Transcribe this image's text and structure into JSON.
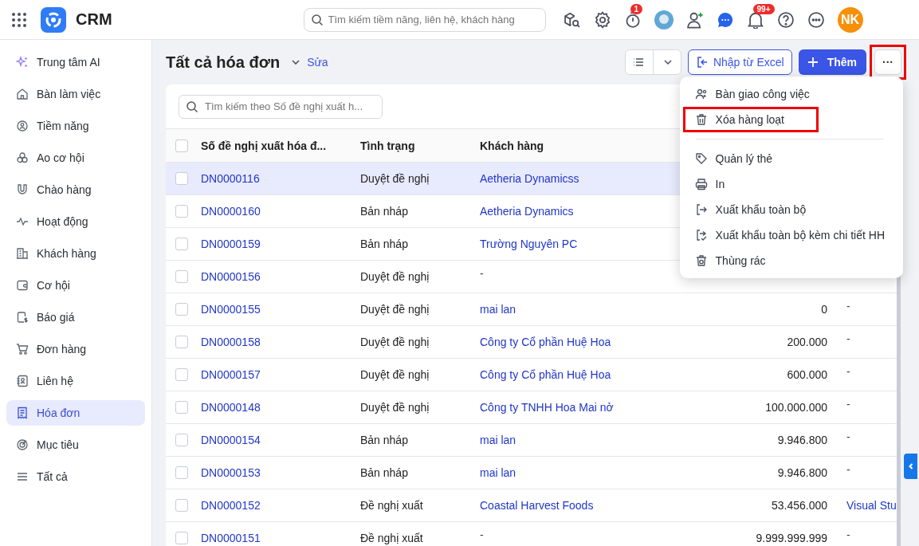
{
  "app": {
    "name": "CRM"
  },
  "search": {
    "placeholder": "Tìm kiếm tiềm năng, liên hệ, khách hàng"
  },
  "notifications": {
    "timer_badge": "1",
    "bell_badge": "99+"
  },
  "user": {
    "initials": "NK"
  },
  "sidebar": {
    "items": [
      {
        "label": "Trung tâm AI",
        "selected": false
      },
      {
        "label": "Bàn làm việc",
        "selected": false
      },
      {
        "label": "Tiềm năng",
        "selected": false
      },
      {
        "label": "Ao cơ hội",
        "selected": false
      },
      {
        "label": "Chào hàng",
        "selected": false
      },
      {
        "label": "Hoạt động",
        "selected": false
      },
      {
        "label": "Khách hàng",
        "selected": false
      },
      {
        "label": "Cơ hội",
        "selected": false
      },
      {
        "label": "Báo giá",
        "selected": false
      },
      {
        "label": "Đơn hàng",
        "selected": false
      },
      {
        "label": "Liên hệ",
        "selected": false
      },
      {
        "label": "Hóa đơn",
        "selected": true
      },
      {
        "label": "Mục tiêu",
        "selected": false
      },
      {
        "label": "Tất cả",
        "selected": false
      }
    ]
  },
  "page": {
    "title": "Tất cả hóa đơn",
    "edit_link": "Sửa",
    "import_button": "Nhập từ Excel",
    "add_button": "Thêm",
    "more_button": {
      "label": "···",
      "highlighted": true
    }
  },
  "table": {
    "search_placeholder": "Tìm kiếm theo Số đề nghị xuất h...",
    "select_all": {
      "checked": false
    },
    "columns": [
      "Số đề nghị xuất hóa đ...",
      "Tình trạng",
      "Khách hàng"
    ],
    "rows": [
      {
        "number": "DN0000116",
        "status": "Duyệt đề nghị",
        "customer": "Aetheria Dynamicss",
        "selected": true,
        "checked": false
      },
      {
        "number": "DN0000160",
        "status": "Bản nháp",
        "customer": "Aetheria Dynamics",
        "selected": false,
        "checked": false
      },
      {
        "number": "DN0000159",
        "status": "Bản nháp",
        "customer": "Trường Nguyên PC",
        "selected": false,
        "checked": false
      },
      {
        "number": "DN0000156",
        "status": "Duyệt đề nghị",
        "customer": "-",
        "customer_link": false,
        "selected": false,
        "checked": false
      },
      {
        "number": "DN0000155",
        "status": "Duyệt đề nghị",
        "customer": "mai lan",
        "amount": "0",
        "column_5": "-",
        "selected": false,
        "checked": false
      },
      {
        "number": "DN0000158",
        "status": "Duyệt đề nghị",
        "customer": "Công ty Cổ phần Huệ Hoa",
        "amount": "200.000",
        "column_5": "-",
        "selected": false,
        "checked": false
      },
      {
        "number": "DN0000157",
        "status": "Duyệt đề nghị",
        "customer": "Công ty Cổ phần Huệ Hoa",
        "amount": "600.000",
        "column_5": "-",
        "selected": false,
        "checked": false
      },
      {
        "number": "DN0000148",
        "status": "Duyệt đề nghị",
        "customer": "Công ty TNHH Hoa Mai nở",
        "amount": "100.000.000",
        "column_5": "-",
        "selected": false,
        "checked": false
      },
      {
        "number": "DN0000154",
        "status": "Bản nháp",
        "customer": "mai lan",
        "amount": "9.946.800",
        "column_5": "-",
        "selected": false,
        "checked": false
      },
      {
        "number": "DN0000153",
        "status": "Bản nháp",
        "customer": "mai lan",
        "amount": "9.946.800",
        "column_5": "-",
        "selected": false,
        "checked": false
      },
      {
        "number": "DN0000152",
        "status": "Đề nghị xuất",
        "customer": "Coastal Harvest Foods",
        "amount": "53.456.000",
        "column_5": "Visual Stu",
        "column_5_link": true,
        "selected": false,
        "checked": false
      },
      {
        "number": "DN0000151",
        "status": "Đề nghị xuất",
        "customer": "-",
        "customer_link": false,
        "amount": "9.999.999.999",
        "column_5": "-",
        "selected": false,
        "checked": false
      }
    ]
  },
  "menu": {
    "groups": [
      [
        {
          "label": "Bàn giao công việc",
          "highlighted": false
        },
        {
          "label": "Xóa hàng loạt",
          "highlighted": true
        }
      ],
      [
        {
          "label": "Quản lý thẻ",
          "highlighted": false
        },
        {
          "label": "In",
          "highlighted": false
        },
        {
          "label": "Xuất khẩu toàn bộ",
          "highlighted": false
        },
        {
          "label": "Xuất khẩu toàn bộ kèm chi tiết HH",
          "highlighted": false
        },
        {
          "label": "Thùng rác",
          "highlighted": false
        }
      ]
    ]
  }
}
